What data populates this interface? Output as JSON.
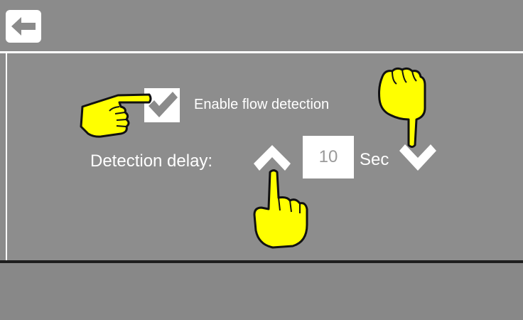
{
  "header": {
    "back_icon": "back-arrow-icon"
  },
  "settings": {
    "flow_detection": {
      "label": "Enable flow detection",
      "checked": true
    },
    "detection_delay": {
      "label": "Detection delay:",
      "value": "10",
      "unit": "Sec"
    }
  },
  "colors": {
    "background": "#8b8b8b",
    "highlight": "#ffff00",
    "foreground": "#ffffff"
  },
  "overlays": {
    "pointer_icons": [
      "pointing-hand-icon",
      "pointing-hand-icon",
      "pointing-hand-icon"
    ]
  }
}
